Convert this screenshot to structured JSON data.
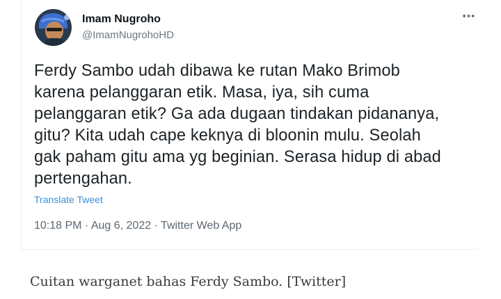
{
  "tweet": {
    "author": {
      "display_name": "Imam Nugroho",
      "handle": "@ImamNugrohoHD",
      "avatar_icon": "profile-avatar"
    },
    "more_icon": "more-options-icon",
    "more_glyph": "•••",
    "text": "Ferdy Sambo udah dibawa ke rutan Mako Brimob\nkarena pelanggaran etik. Masa, iya, sih cuma\npelanggaran etik? Ga ada dugaan tindakan pidananya,\ngitu? Kita udah cape keknya di bloonin mulu. Seolah\ngak paham gitu ama yg beginian. Serasa hidup di abad\npertengahan.",
    "translate_label": "Translate Tweet",
    "meta": "10:18 PM · Aug 6, 2022 · Twitter Web App",
    "colors": {
      "link": "#3a8fd8",
      "text": "#1c2226",
      "secondary": "#6b7680"
    }
  },
  "caption": "Cuitan warganet bahas Ferdy Sambo. [Twitter]"
}
